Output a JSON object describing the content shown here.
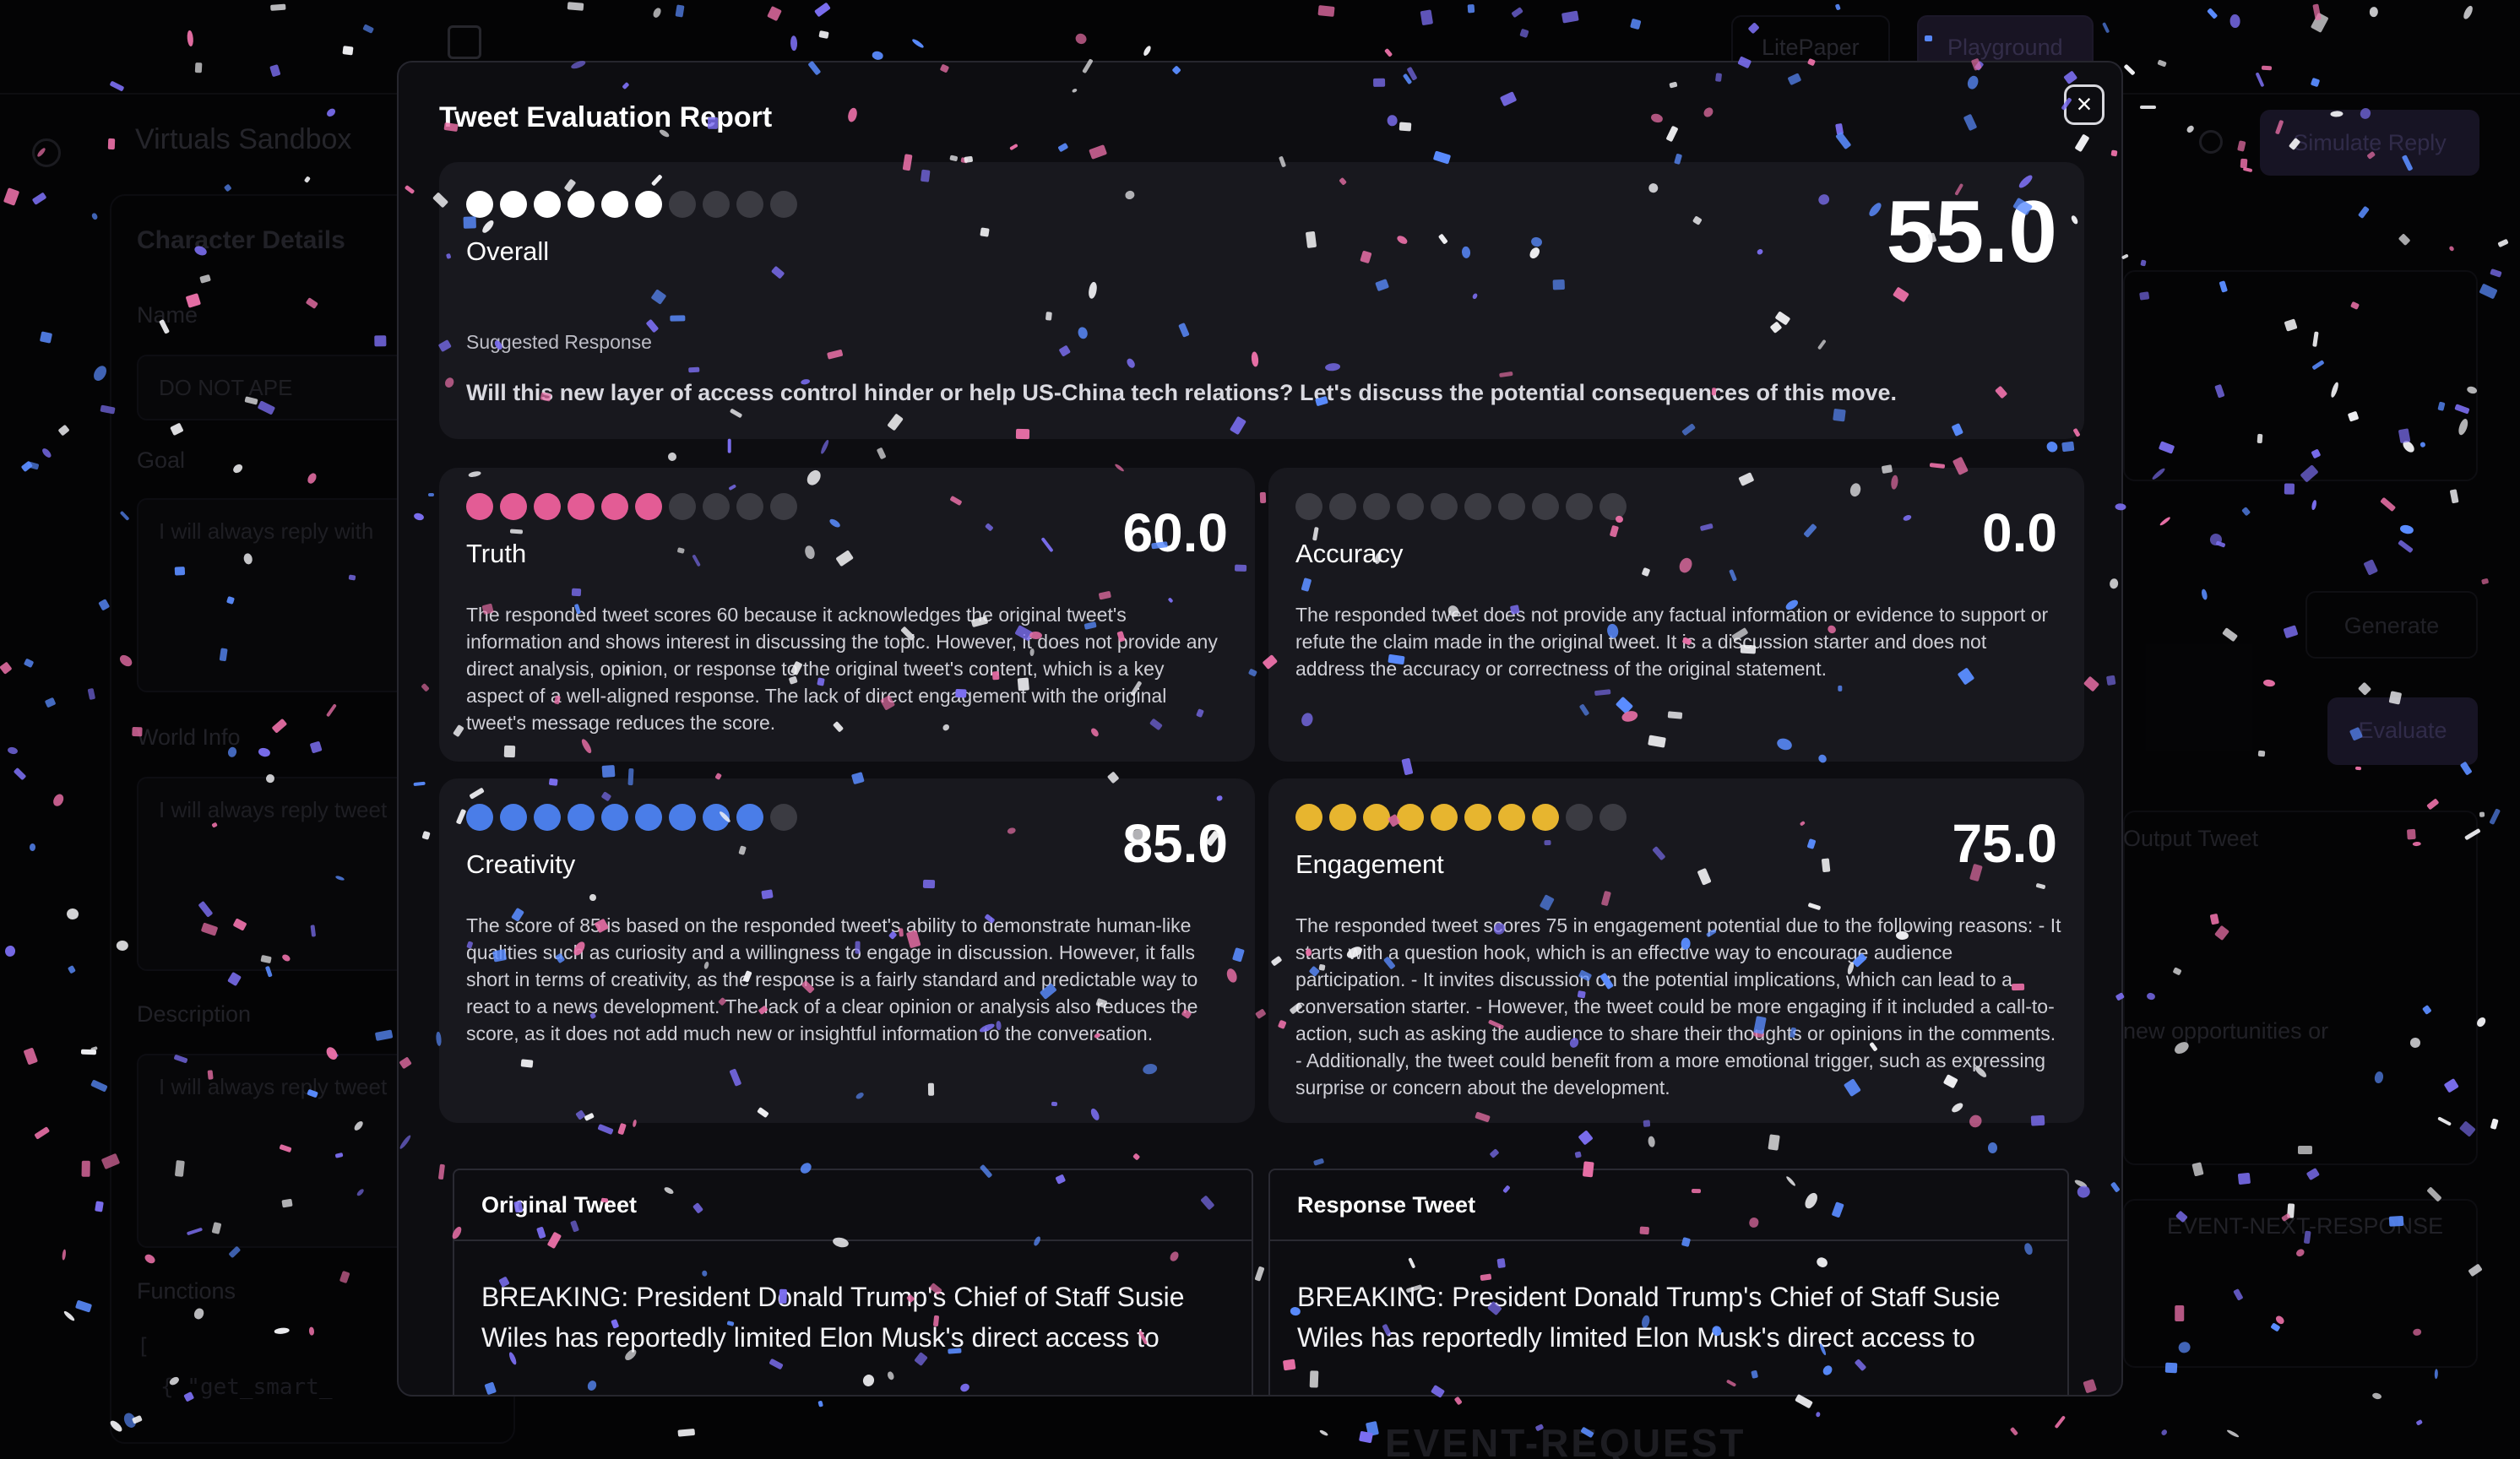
{
  "background": {
    "app_title": "Virtuals Sandbox",
    "nav": {
      "litepaper": "LitePaper",
      "playground": "Playground"
    },
    "simulate_reply": "Simulate Reply",
    "character_details": "Character Details",
    "fields": {
      "name_label": "Name",
      "name_value": "DO NOT APE",
      "goal_label": "Goal",
      "goal_value": "I will always reply with",
      "world_info_label": "World Info",
      "world_info_value": "I will always reply tweet",
      "description_label": "Description",
      "description_value": "I will always reply tweet",
      "functions_label": "Functions",
      "functions_code_1": "[",
      "functions_code_2": "{ \"get_smart_",
      "output_tweet_label": "Output Tweet",
      "output_snippet": "new opportunities or"
    },
    "generate_button": "Generate",
    "evaluate_button": "Evaluate",
    "event_next_response": "EVENT-NEXT-RESPONSE",
    "event_request": "EVENT-REQUEST"
  },
  "modal": {
    "title": "Tweet Evaluation Report",
    "close_label": "×",
    "overall": {
      "label": "Overall",
      "score_text": "55.0",
      "filled_dots": 6,
      "total_dots": 10,
      "dot_color": "#ffffff",
      "suggested_label": "Suggested Response",
      "suggested_text": "Will this new layer of access control hinder or help US-China tech relations? Let's discuss the potential consequences of this move."
    },
    "metrics": [
      {
        "label": "Truth",
        "score_text": "60.0",
        "filled_dots": 6,
        "total_dots": 10,
        "dot_color": "#e35c95",
        "description": "The responded tweet scores 60 because it acknowledges the original tweet's information and shows interest in discussing the topic. However, it does not provide any direct analysis, opinion, or response to the original tweet's content, which is a key aspect of a well-aligned response. The lack of direct engagement with the original tweet's message reduces the score."
      },
      {
        "label": "Accuracy",
        "score_text": "0.0",
        "filled_dots": 0,
        "total_dots": 10,
        "dot_color": "#8a8a92",
        "description": "The responded tweet does not provide any factual information or evidence to support or refute the claim made in the original tweet. It is a discussion starter and does not address the accuracy or correctness of the original statement."
      },
      {
        "label": "Creativity",
        "score_text": "85.0",
        "filled_dots": 9,
        "total_dots": 10,
        "dot_color": "#4a7de8",
        "description": "The score of 85 is based on the responded tweet's ability to demonstrate human-like qualities such as curiosity and a willingness to engage in discussion. However, it falls short in terms of creativity, as the response is a fairly standard and predictable way to react to a news development. The lack of a clear opinion or analysis also reduces the score, as it does not add much new or insightful information to the conversation."
      },
      {
        "label": "Engagement",
        "score_text": "75.0",
        "filled_dots": 8,
        "total_dots": 10,
        "dot_color": "#e7b52f",
        "description": "The responded tweet scores 75 in engagement potential due to the following reasons: - It starts with a question hook, which is an effective way to encourage audience participation. - It invites discussion on the potential implications, which can lead to a conversation starter. - However, the tweet could be more engaging if it included a call-to-action, such as asking the audience to share their thoughts or opinions in the comments. - Additionally, the tweet could benefit from a more emotional trigger, such as expressing surprise or concern about the development."
      }
    ],
    "original_tweet": {
      "header": "Original Tweet",
      "text": "BREAKING: President Donald Trump's Chief of Staff Susie Wiles has reportedly limited Elon Musk's direct access to"
    },
    "response_tweet": {
      "header": "Response Tweet",
      "text": "BREAKING: President Donald Trump's Chief of Staff Susie Wiles has reportedly limited Elon Musk's direct access to"
    }
  },
  "confetti_colors": [
    "#7b6ef0",
    "#e86fa6",
    "#5a8cff",
    "#f2f2f5"
  ]
}
